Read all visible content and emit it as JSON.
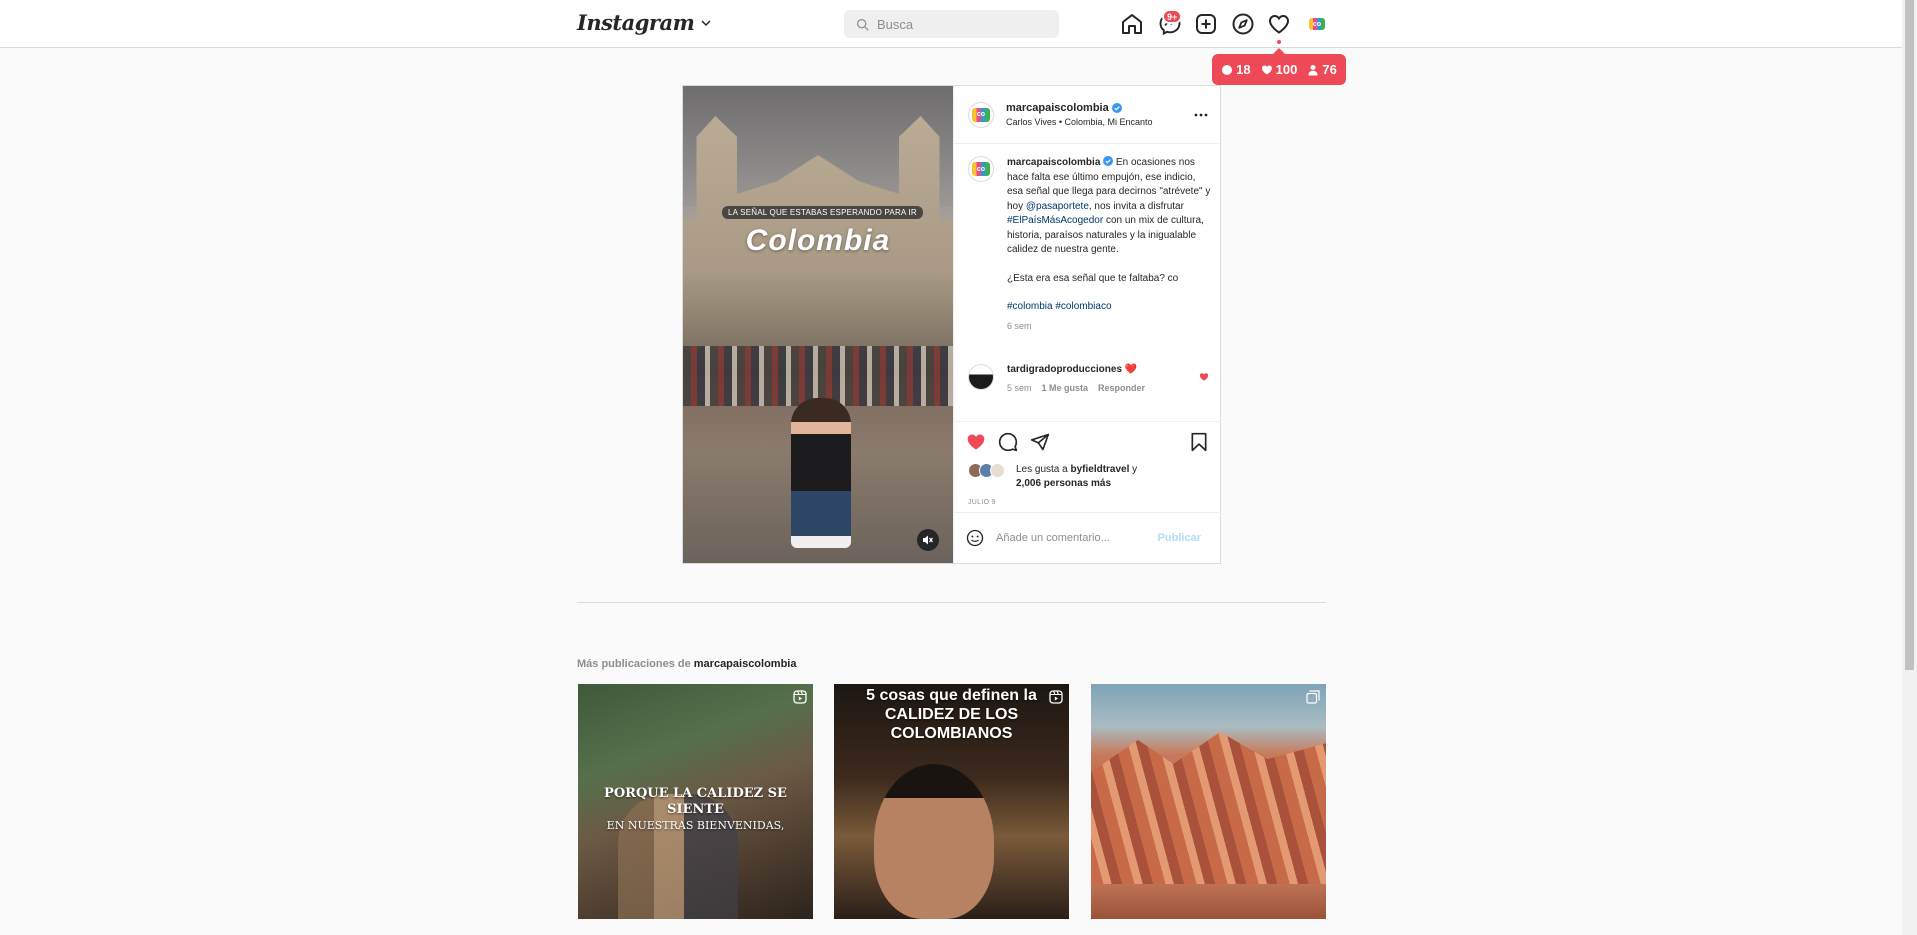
{
  "nav": {
    "logo": "Instagram",
    "search_placeholder": "Busca",
    "messages_badge": "9+"
  },
  "activity": {
    "comments": "18",
    "likes": "100",
    "followers": "76"
  },
  "post": {
    "username": "marcapaiscolombia",
    "audio": "Carlos Vives • Colombia, Mi Encanto",
    "media_tagline": "LA SEÑAL QUE ESTABAS ESPERANDO PARA IR",
    "media_title": "Colombia",
    "caption": {
      "username": "marcapaiscolombia",
      "text_1": " En ocasiones nos hace falta ese último empujón, ese indicio, esa señal que llega para decirnos \"atrévete\" y hoy ",
      "mention": "@pasaportete",
      "text_2": ", nos invita a disfrutar ",
      "hashtag_main": "#ElPaísMásAcogedor",
      "text_3": " con un mix de cultura, historia, paraísos naturales y la inigualable calidez de nuestra gente.",
      "question": "¿Esta era esa señal que te faltaba? co",
      "hashtag_1": "#colombia",
      "hashtag_2": "#colombiaco",
      "time": "6 sem"
    },
    "comment": {
      "username": "tardigradoproducciones",
      "text": " ❤️",
      "time": "5 sem",
      "likes": "1 Me gusta",
      "reply": "Responder"
    },
    "likes": {
      "prefix": "Les gusta a ",
      "user": "byfieldtravel",
      "middle": " y",
      "others": "2,006 personas más"
    },
    "date": "JULIO 9",
    "add_comment_placeholder": "Añade un comentario...",
    "publish": "Publicar"
  },
  "more": {
    "prefix": "Más publicaciones de ",
    "username": "marcapaiscolombia",
    "items": [
      {
        "text": "PORQUE LA CALIDEZ SE SIENTE",
        "sub": "EN NUESTRAS BIENVENIDAS,",
        "icon": "reel-icon"
      },
      {
        "text": "5 cosas que definen la CALIDEZ DE LOS COLOMBIANOS",
        "icon": "reel-icon"
      },
      {
        "text": "",
        "icon": "carousel-icon"
      }
    ]
  },
  "colors": {
    "accent_red": "#ed4956",
    "link_blue": "#00376b",
    "publish_disabled": "#b2dffc",
    "verified_blue": "#3897f0"
  }
}
